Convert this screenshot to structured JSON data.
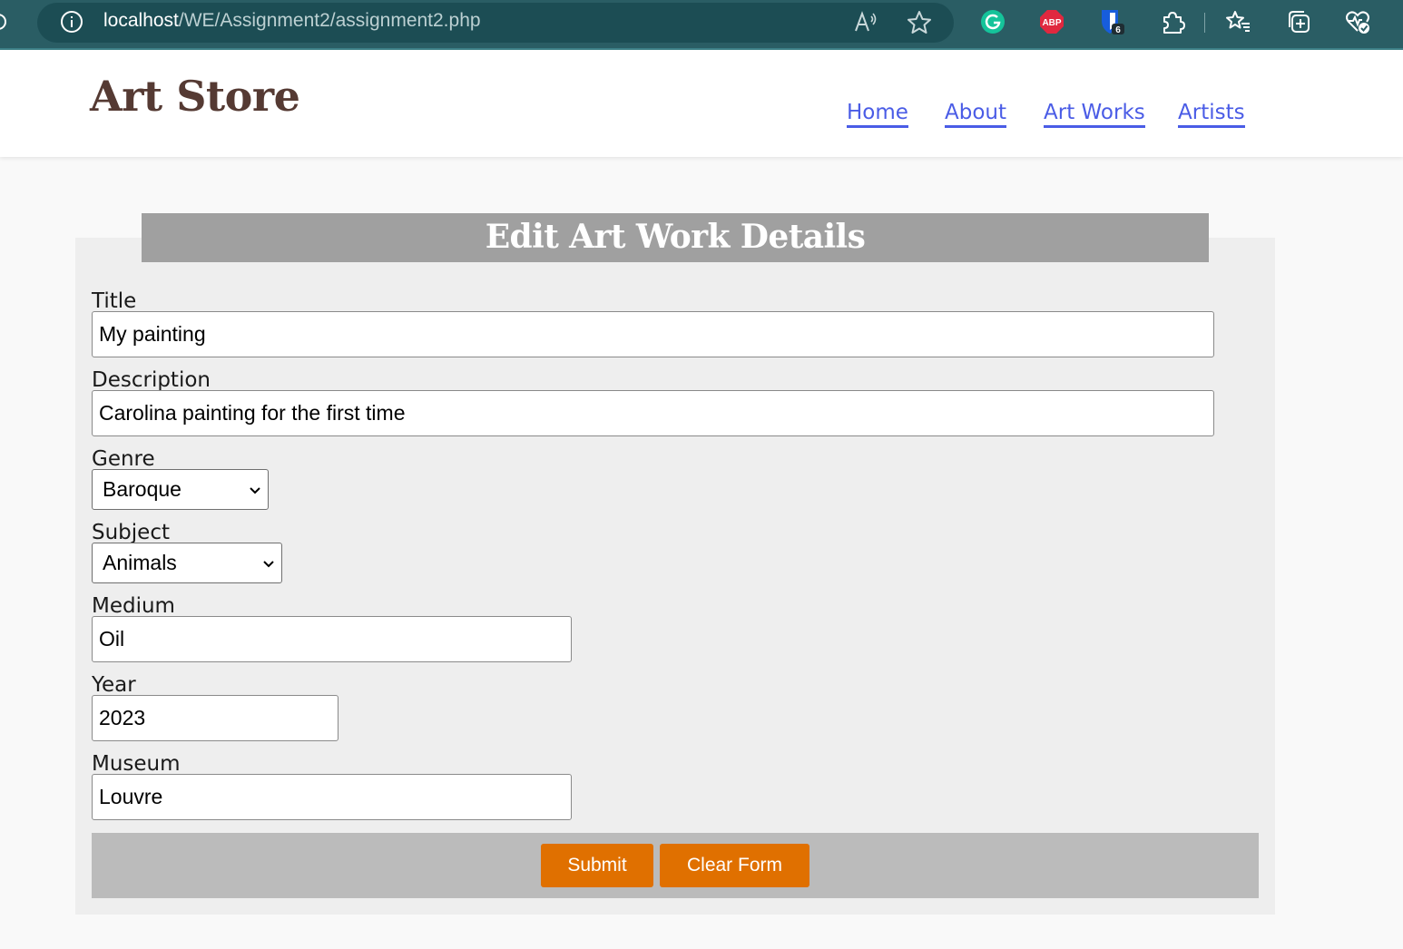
{
  "browser": {
    "url_host": "localhost",
    "url_path": "/WE/Assignment2/assignment2.php",
    "extensions": {
      "abp_label": "ABP",
      "bitwarden_badge": "6"
    }
  },
  "header": {
    "site_title": "Art Store",
    "nav": [
      {
        "label": "Home"
      },
      {
        "label": "About"
      },
      {
        "label": "Art Works"
      },
      {
        "label": "Artists"
      }
    ]
  },
  "form": {
    "heading": "Edit Art Work Details",
    "title": {
      "label": "Title",
      "value": "My painting"
    },
    "description": {
      "label": "Description",
      "value": "Carolina painting for the first time"
    },
    "genre": {
      "label": "Genre",
      "selected": "Baroque"
    },
    "subject": {
      "label": "Subject",
      "selected": "Animals"
    },
    "medium": {
      "label": "Medium",
      "value": "Oil"
    },
    "year": {
      "label": "Year",
      "value": "2023"
    },
    "museum": {
      "label": "Museum",
      "value": "Louvre"
    },
    "buttons": {
      "submit": "Submit",
      "clear": "Clear Form"
    }
  },
  "colors": {
    "browser_bar": "#2a5d64",
    "title_brown": "#553a33",
    "nav_link": "#4a5ce6",
    "button_orange": "#e07000",
    "heading_bar": "#a0a0a0"
  }
}
